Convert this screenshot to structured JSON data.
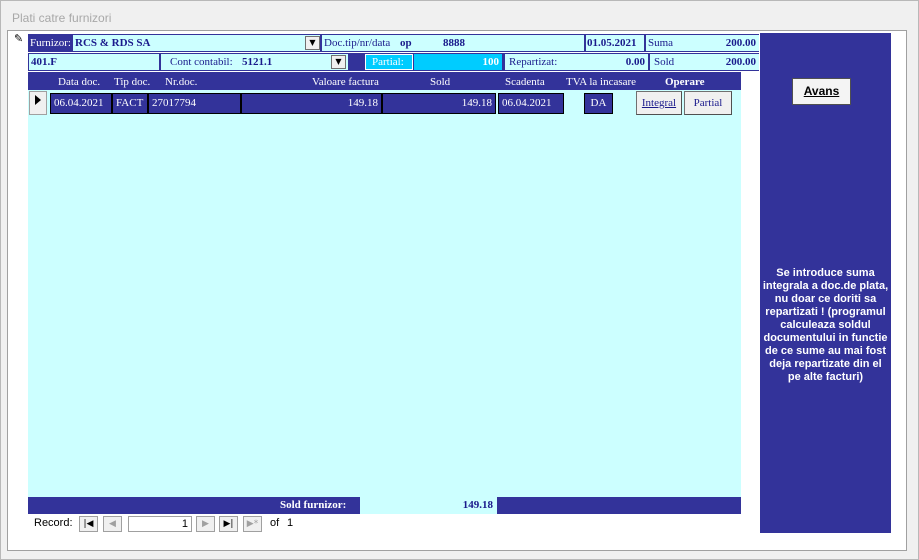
{
  "window": {
    "title": "Plati catre furnizori"
  },
  "header": {
    "furnizor_label": "Furnizor:",
    "furnizor_value": "RCS & RDS SA",
    "doc_label": "Doc.tip/nr/data",
    "doc_tip": "op",
    "doc_nr": "8888",
    "doc_data": "01.05.2021",
    "suma_label": "Suma",
    "suma_value": "200.00",
    "cont_furnizor": "401.F",
    "cont_contabil_label": "Cont contabil:",
    "cont_contabil_value": "5121.1",
    "partial_label": "Partial:",
    "partial_value": "100",
    "repartizat_label": "Repartizat:",
    "repartizat_value": "0.00",
    "sold_label": "Sold",
    "sold_value": "200.00"
  },
  "columns": {
    "data_doc": "Data doc.",
    "tip_doc": "Tip doc.",
    "nr_doc": "Nr.doc.",
    "valoare_factura": "Valoare factura",
    "sold": "Sold",
    "scadenta": "Scadenta",
    "tva": "TVA la incasare",
    "operare": "Operare"
  },
  "rows": [
    {
      "data_doc": "06.04.2021",
      "tip_doc": "FACT",
      "nr_doc": "27017794",
      "valoare_factura": "149.18",
      "sold": "149.18",
      "scadenta": "06.04.2021",
      "tva": "DA",
      "integral_label": "Integral",
      "partial_label": "Partial"
    }
  ],
  "side": {
    "avans_label": "Avans",
    "note": "Se introduce suma integrala a doc.de plata, nu doar  ce doriti sa repartizati ! (programul calculeaza soldul documentului in functie de ce sume au mai fost deja repartizate din el  pe alte  facturi)"
  },
  "footer": {
    "sold_furnizor_label": "Sold furnizor:",
    "sold_furnizor_value": "149.18"
  },
  "navigation": {
    "record_label": "Record:",
    "current": "1",
    "of_label": "of",
    "total": "1"
  },
  "colors": {
    "panel_blue": "#33339a",
    "field_cyan": "#ccffff",
    "text_navy": "#1a1a8c"
  }
}
